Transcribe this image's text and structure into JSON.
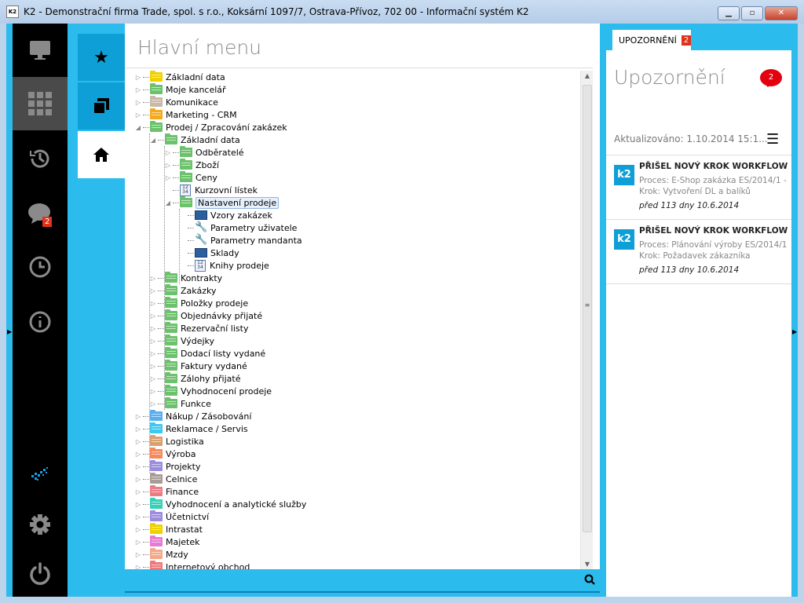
{
  "window": {
    "title": "K2 - Demonstrační firma Trade, spol. s r.o., Koksární 1097/7, Ostrava-Přívoz, 702 00 - Informační systém K2",
    "logo": "K2"
  },
  "sidebar": {
    "chat_badge": "2",
    "items": [
      "monitor-icon",
      "apps-grid-icon",
      "history-icon",
      "chat-icon",
      "clock-icon",
      "info-icon",
      "k2-logo-icon",
      "gear-icon",
      "power-icon"
    ]
  },
  "main": {
    "title": "Hlavní menu",
    "tree": [
      {
        "label": "Základní data",
        "level": 0,
        "type": "folder",
        "color": "#f0d000",
        "exp": "c"
      },
      {
        "label": "Moje kancelář",
        "level": 0,
        "type": "folder",
        "color": "#6cc26c",
        "exp": "c"
      },
      {
        "label": "Komunikace",
        "level": 0,
        "type": "folder",
        "color": "#c8b8a8",
        "exp": "c"
      },
      {
        "label": "Marketing - CRM",
        "level": 0,
        "type": "folder",
        "color": "#f4a81c",
        "exp": "c"
      },
      {
        "label": "Prodej / Zpracování zakázek",
        "level": 0,
        "type": "folder",
        "color": "#6cc26c",
        "exp": "o"
      },
      {
        "label": "Základní data",
        "level": 1,
        "type": "folder",
        "color": "#6cc26c",
        "exp": "o"
      },
      {
        "label": "Odběratelé",
        "level": 2,
        "type": "folder",
        "color": "#6cc26c",
        "exp": "c"
      },
      {
        "label": "Zboží",
        "level": 2,
        "type": "folder",
        "color": "#6cc26c",
        "exp": "c"
      },
      {
        "label": "Ceny",
        "level": 2,
        "type": "folder",
        "color": "#6cc26c",
        "exp": "c"
      },
      {
        "label": "Kurzovní lístek",
        "level": 2,
        "type": "doc",
        "exp": ""
      },
      {
        "label": "Nastavení prodeje",
        "level": 2,
        "type": "folder",
        "color": "#6cc26c",
        "exp": "o",
        "selected": true
      },
      {
        "label": "Vzory zakázek",
        "level": 3,
        "type": "book",
        "exp": ""
      },
      {
        "label": "Parametry uživatele",
        "level": 3,
        "type": "wrench",
        "exp": ""
      },
      {
        "label": "Parametry mandanta",
        "level": 3,
        "type": "wrench",
        "exp": ""
      },
      {
        "label": "Sklady",
        "level": 3,
        "type": "book",
        "exp": ""
      },
      {
        "label": "Knihy prodeje",
        "level": 3,
        "type": "doc",
        "exp": ""
      },
      {
        "label": "Kontrakty",
        "level": 1,
        "type": "folder",
        "color": "#6cc26c",
        "exp": "c"
      },
      {
        "label": "Zakázky",
        "level": 1,
        "type": "folder",
        "color": "#6cc26c",
        "exp": "c"
      },
      {
        "label": "Položky prodeje",
        "level": 1,
        "type": "folder",
        "color": "#6cc26c",
        "exp": "c"
      },
      {
        "label": "Objednávky přijaté",
        "level": 1,
        "type": "folder",
        "color": "#6cc26c",
        "exp": "c"
      },
      {
        "label": "Rezervační listy",
        "level": 1,
        "type": "folder",
        "color": "#6cc26c",
        "exp": "c"
      },
      {
        "label": "Výdejky",
        "level": 1,
        "type": "folder",
        "color": "#6cc26c",
        "exp": "c"
      },
      {
        "label": "Dodací listy vydané",
        "level": 1,
        "type": "folder",
        "color": "#6cc26c",
        "exp": "c"
      },
      {
        "label": "Faktury vydané",
        "level": 1,
        "type": "folder",
        "color": "#6cc26c",
        "exp": "c"
      },
      {
        "label": "Zálohy přijaté",
        "level": 1,
        "type": "folder",
        "color": "#6cc26c",
        "exp": "c"
      },
      {
        "label": "Vyhodnocení prodeje",
        "level": 1,
        "type": "folder",
        "color": "#6cc26c",
        "exp": "c"
      },
      {
        "label": "Funkce",
        "level": 1,
        "type": "folder",
        "color": "#6cc26c",
        "exp": "c"
      },
      {
        "label": "Nákup / Zásobování",
        "level": 0,
        "type": "folder",
        "color": "#5aaef0",
        "exp": "c"
      },
      {
        "label": "Reklamace / Servis",
        "level": 0,
        "type": "folder",
        "color": "#3cc8f0",
        "exp": "c"
      },
      {
        "label": "Logistika",
        "level": 0,
        "type": "folder",
        "color": "#d8a070",
        "exp": "c"
      },
      {
        "label": "Výroba",
        "level": 0,
        "type": "folder",
        "color": "#f8885a",
        "exp": "c"
      },
      {
        "label": "Projekty",
        "level": 0,
        "type": "folder",
        "color": "#9c8ce0",
        "exp": "c"
      },
      {
        "label": "Celnice",
        "level": 0,
        "type": "folder",
        "color": "#a89c98",
        "exp": "c"
      },
      {
        "label": "Finance",
        "level": 0,
        "type": "folder",
        "color": "#ec7c84",
        "exp": "c"
      },
      {
        "label": "Vyhodnocení a analytické služby",
        "level": 0,
        "type": "folder",
        "color": "#38d0b8",
        "exp": "c"
      },
      {
        "label": "Účetnictví",
        "level": 0,
        "type": "folder",
        "color": "#9c8ce0",
        "exp": "c"
      },
      {
        "label": "Intrastat",
        "level": 0,
        "type": "folder",
        "color": "#f0d000",
        "exp": "c"
      },
      {
        "label": "Majetek",
        "level": 0,
        "type": "folder",
        "color": "#e878d0",
        "exp": "c"
      },
      {
        "label": "Mzdy",
        "level": 0,
        "type": "folder",
        "color": "#f4a888",
        "exp": "c"
      },
      {
        "label": "Internetový obchod",
        "level": 0,
        "type": "folder",
        "color": "#f07878",
        "exp": "c"
      }
    ]
  },
  "notifications": {
    "tab_label": "UPOZORNĚNÍ",
    "tab_count": "2",
    "title": "Upozornění",
    "bubble_count": "2",
    "updated": "Aktualizováno: 1.10.2014 15:1...",
    "items": [
      {
        "title": "PŘIŠEL NOVÝ KROK WORKFLOW",
        "process": "Proces: E-Shop zakázka ES/2014/1 - ...",
        "step": "Krok: Vytvoření DL a balíků",
        "date": "před 113 dny 10.6.2014",
        "icon": "k2"
      },
      {
        "title": "PŘIŠEL NOVÝ KROK WORKFLOW",
        "process": "Proces: Plánování výroby ES/2014/1 ...",
        "step": "Krok: Požadavek zákazníka",
        "date": "před 113 dny 10.6.2014",
        "icon": "k2"
      }
    ]
  }
}
